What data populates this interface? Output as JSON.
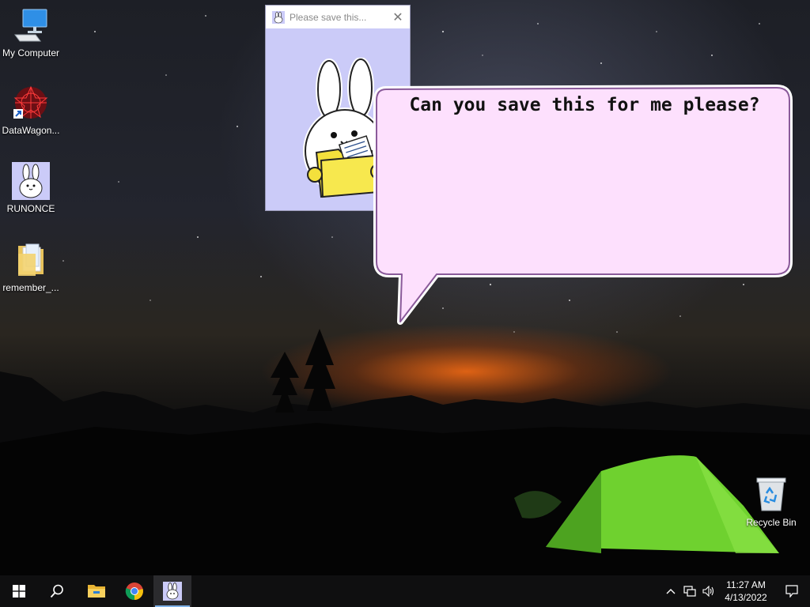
{
  "desktop": {
    "icons": [
      {
        "label": "My Computer",
        "icon": "computer-icon"
      },
      {
        "label": "DataWagon...",
        "icon": "datawagon-icon"
      },
      {
        "label": "RUNONCE",
        "icon": "bunny-icon"
      },
      {
        "label": "remember_...",
        "icon": "folder-icon"
      },
      {
        "label": "Recycle Bin",
        "icon": "recycle-bin-icon"
      }
    ]
  },
  "window": {
    "title": "Please save this...",
    "close_glyph": "✕"
  },
  "bubble": {
    "text": "Can you save this for me please?"
  },
  "taskbar": {
    "time": "11:27 AM",
    "date": "4/13/2022",
    "apps": [
      "start-icon",
      "search-icon",
      "file-explorer-icon",
      "chrome-icon",
      "bunny-app-icon"
    ]
  },
  "colors": {
    "window_bg": "#cbcbf8",
    "bubble_fill": "#fde0fd",
    "bubble_border": "#8a5a9a",
    "taskbar": "#0f0f10",
    "folder_yellow": "#f4e03c"
  }
}
